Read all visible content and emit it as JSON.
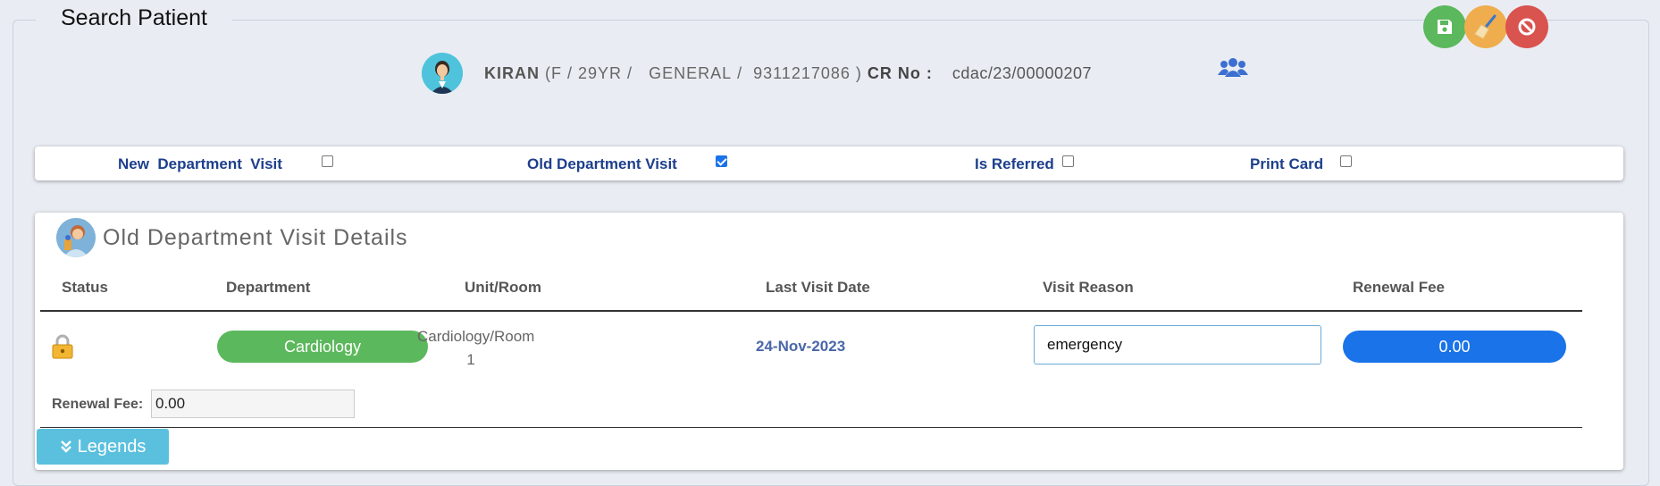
{
  "page": {
    "title": "Search Patient"
  },
  "actions": {
    "save_icon": "floppy-disk-icon",
    "clear_icon": "broom-icon",
    "cancel_icon": "ban-icon"
  },
  "patient": {
    "name": "KIRAN",
    "gender": "F",
    "age": "29YR",
    "category": "GENERAL",
    "phone": "9311217086",
    "cr_label": "CR No :",
    "cr_no": "cdac/23/00000207"
  },
  "visit_options": {
    "new_department_visit": {
      "label": "New  Department  Visit",
      "checked": false
    },
    "old_department_visit": {
      "label": "Old Department Visit",
      "checked": true
    },
    "is_referred": {
      "label": "Is Referred",
      "checked": false
    },
    "print_card": {
      "label": "Print Card",
      "checked": false
    }
  },
  "details": {
    "title": "Old Department Visit Details",
    "columns": [
      "Status",
      "Department",
      "Unit/Room",
      "Last Visit Date",
      "Visit Reason",
      "Renewal Fee"
    ],
    "row": {
      "status_icon": "lock-icon",
      "department": "Cardiology",
      "unit_room_line1": "Cardiology/Room",
      "unit_room_line2": "1",
      "last_visit_date": "24-Nov-2023",
      "visit_reason": "emergency",
      "renewal_fee": "0.00"
    },
    "renewal_fee_label": "Renewal Fee:",
    "renewal_fee_value": "0.00"
  },
  "legends_button": {
    "label": "Legends"
  },
  "colors": {
    "save": "#5cb85c",
    "clear": "#f0ad4e",
    "cancel": "#d9534f",
    "department_badge": "#5cb85c",
    "fee_badge": "#1a73e8",
    "legends": "#5bc0de",
    "label_blue": "#1d3f8c"
  }
}
